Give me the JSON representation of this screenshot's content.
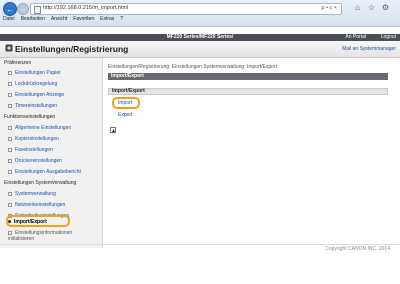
{
  "browser": {
    "address": "http://192.168.0.215/m_import.html",
    "address_tools": "ρ • c ×",
    "menu": [
      "Datei",
      "Bearbeiten",
      "Ansicht",
      "Favoriten",
      "Extras",
      "?"
    ]
  },
  "header": {
    "device": "MF220 Series/MF220 Series/",
    "portal": "An Portal",
    "logout": "Logout",
    "title": "Einstellungen/Registrierung",
    "mail": "Mail an Systemmanager"
  },
  "sidebar": {
    "section1": "Präferenzen",
    "items1": [
      "Einstellungen Papier",
      "Lockdrückregelung",
      "Einstellungen Anzeige",
      "Timereinstellungen"
    ],
    "section2": "Funktionseinstellungen",
    "items2": [
      "Allgemeine Einstellungen",
      "Kopiereinstellungen",
      "Faxeinstellungen",
      "Druckereinstellungen",
      "Einstellungen Ausgabebericht"
    ],
    "section3": "Einstellungen Systemverwaltung",
    "items3": [
      "Systemverwaltung",
      "Netzwerkeinstellungen",
      "Sicherheitseinstellungen",
      "Import/Export",
      "Einstellungsinformationen initialisieren"
    ]
  },
  "main": {
    "breadcrumb": "Einstellungen/Registrierung: Einstellungen Systemverwaltung: Import/Export",
    "panel_title": "Import/Export",
    "sub_title": "Import/Export",
    "import": "Import",
    "export": "Export"
  },
  "footer": {
    "copyright": "Copyright CANON INC. 2014"
  }
}
